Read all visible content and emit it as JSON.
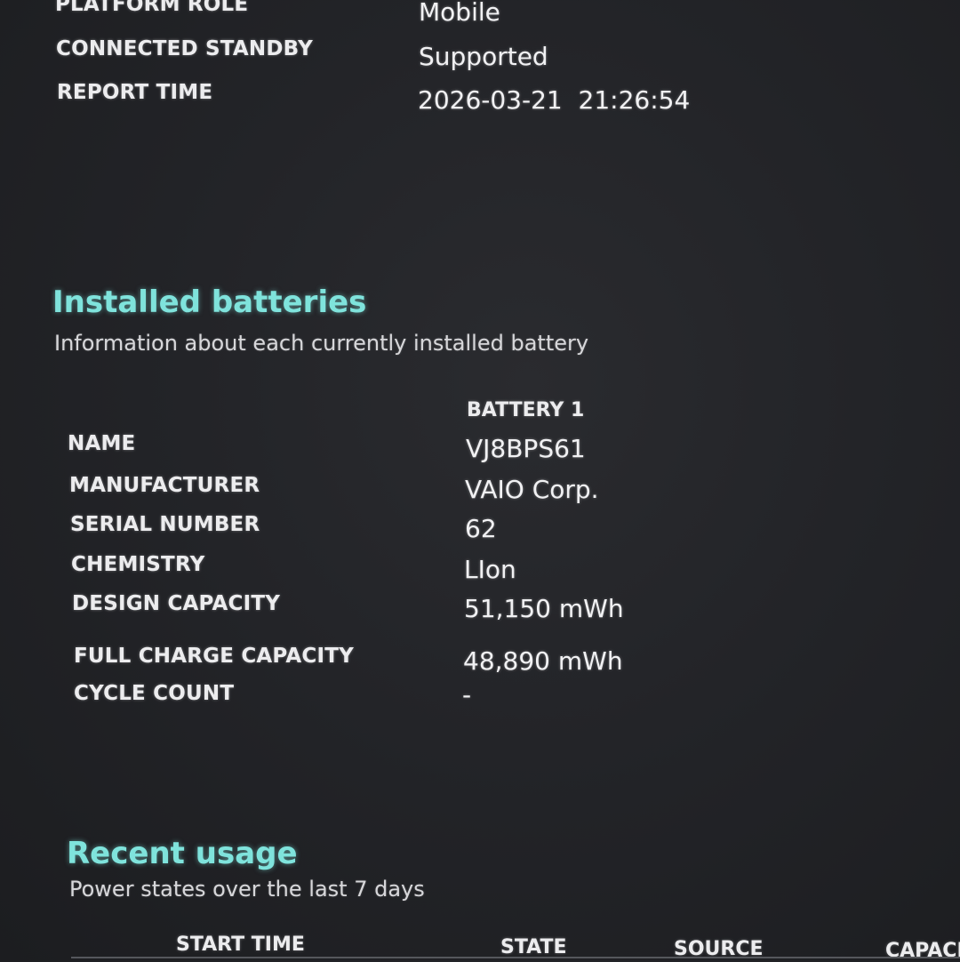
{
  "system_info": {
    "rows": [
      {
        "label": "PLATFORM ROLE",
        "value": "Mobile"
      },
      {
        "label": "CONNECTED STANDBY",
        "value": "Supported"
      },
      {
        "label": "REPORT TIME",
        "value": "2026-03-21  21:26:54"
      }
    ]
  },
  "installed_batteries": {
    "title": "Installed batteries",
    "subtitle": "Information about each currently installed battery",
    "column_header": "BATTERY 1",
    "rows": [
      {
        "label": "NAME",
        "value": "VJ8BPS61"
      },
      {
        "label": "MANUFACTURER",
        "value": "VAIO Corp."
      },
      {
        "label": "SERIAL NUMBER",
        "value": "62"
      },
      {
        "label": "CHEMISTRY",
        "value": "LIon"
      },
      {
        "label": "DESIGN CAPACITY",
        "value": "51,150 mWh"
      },
      {
        "label": "FULL CHARGE CAPACITY",
        "value": "48,890 mWh"
      },
      {
        "label": "CYCLE COUNT",
        "value": "-"
      }
    ]
  },
  "recent_usage": {
    "title": "Recent usage",
    "subtitle": "Power states over the last 7 days",
    "columns": [
      "START TIME",
      "STATE",
      "SOURCE",
      "CAPACI"
    ]
  }
}
